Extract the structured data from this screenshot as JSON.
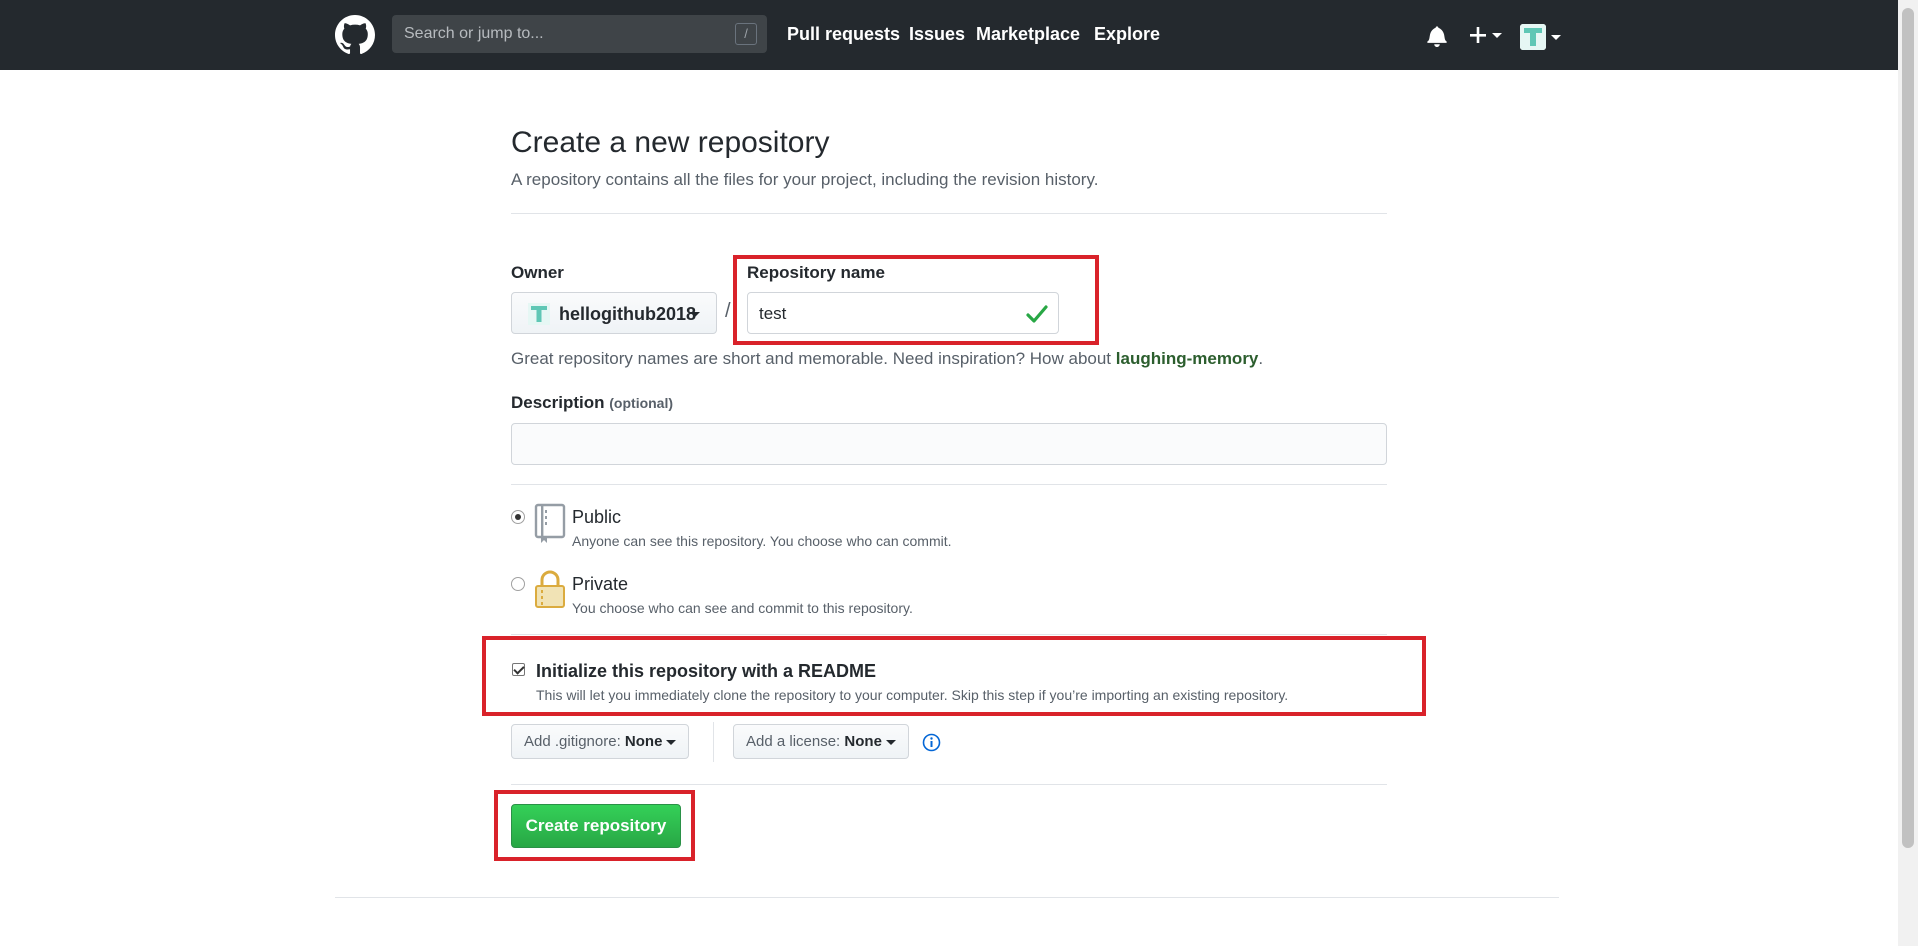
{
  "header": {
    "search_placeholder": "Search or jump to...",
    "search_shortcut": "/",
    "nav": [
      "Pull requests",
      "Issues",
      "Marketplace",
      "Explore"
    ],
    "icons": [
      "github-logo-icon",
      "bell-icon",
      "plus-icon",
      "avatar-icon"
    ]
  },
  "page": {
    "title": "Create a new repository",
    "subtitle": "A repository contains all the files for your project, including the revision history."
  },
  "form": {
    "owner_label": "Owner",
    "owner_value": "hellogithub2018",
    "separator": "/",
    "repo_label": "Repository name",
    "repo_value": "test",
    "hint_prefix": "Great repository names are short and memorable. Need inspiration? How about ",
    "hint_link": "laughing-memory",
    "hint_suffix": ".",
    "description_label": "Description",
    "description_optional": "(optional)",
    "description_value": "",
    "visibility": {
      "public_title": "Public",
      "public_desc": "Anyone can see this repository. You choose who can commit.",
      "private_title": "Private",
      "private_desc": "You choose who can see and commit to this repository.",
      "selected": "Public"
    },
    "init": {
      "title": "Initialize this repository with a README",
      "desc": "This will let you immediately clone the repository to your computer. Skip this step if you’re importing an existing repository.",
      "checked": true
    },
    "gitignore_label": "Add .gitignore:",
    "gitignore_value": "None",
    "license_label": "Add a license:",
    "license_value": "None",
    "create_button": "Create repository"
  },
  "colors": {
    "header_bg": "#24292e",
    "create_button": "#28a745",
    "highlight": "#d9222a",
    "check": "#28a745"
  }
}
